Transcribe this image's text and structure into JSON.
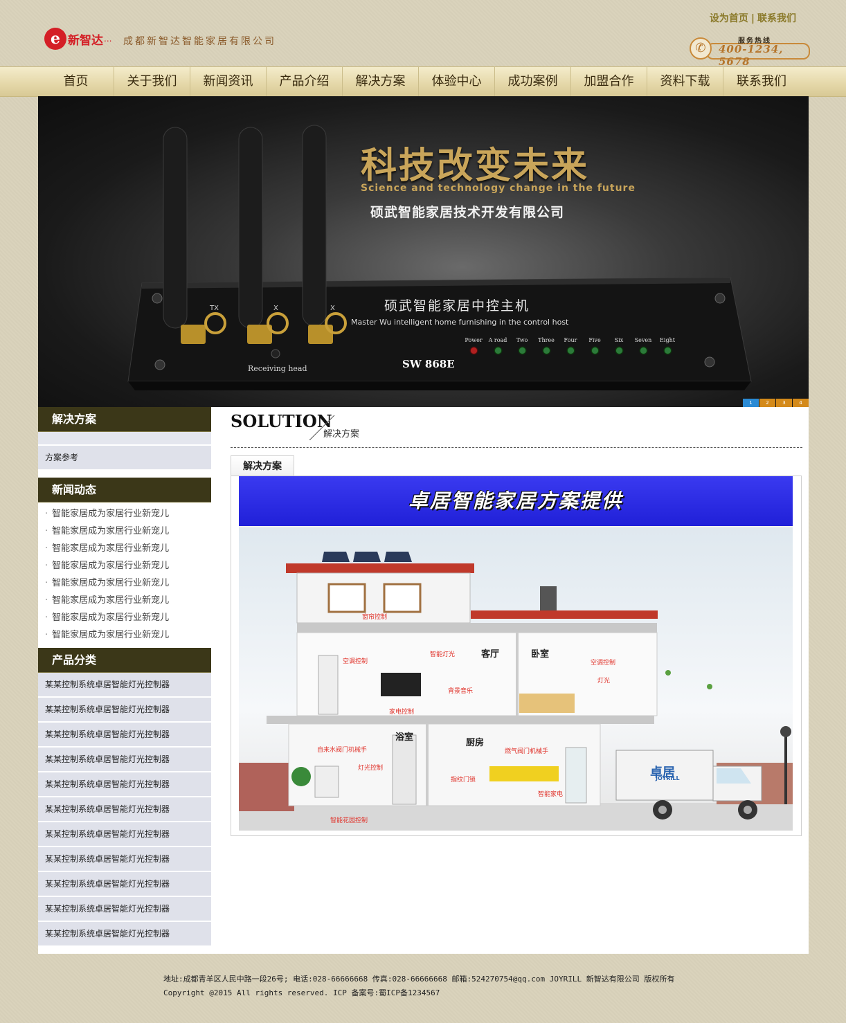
{
  "header": {
    "logo_text": "新智达",
    "logo_dots": "...",
    "company_name": "成都新智达智能家居有限公司",
    "links": [
      "设为首页",
      "联系我们"
    ],
    "hotline_label": "服务热线",
    "hotline_number": "400-1234, 5678"
  },
  "nav": [
    "首页",
    "关于我们",
    "新闻资讯",
    "产品介绍",
    "解决方案",
    "体验中心",
    "成功案例",
    "加盟合作",
    "资料下载",
    "联系我们"
  ],
  "banner": {
    "title": "科技改变未来",
    "subtitle": "Science and technology change in the future",
    "company": "硕武智能家居技术开发有限公司",
    "device_name": "硕武智能家居中控主机",
    "device_english": "Master Wu intelligent home furnishing in the control host",
    "device_model": "SW 868E",
    "receiving_label": "Receiving head",
    "antenna_labels": [
      "TX",
      "X",
      "X"
    ],
    "leds": [
      "Power",
      "A road",
      "Two",
      "Three",
      "Four",
      "Five",
      "Six",
      "Seven",
      "Eight"
    ],
    "pager": [
      "1",
      "2",
      "3",
      "4"
    ]
  },
  "sidebar": {
    "solutions_title": "解决方案",
    "solutions_items": [
      "方案参考"
    ],
    "news_title": "新闻动态",
    "news_items": [
      "智能家居成为家居行业新宠儿",
      "智能家居成为家居行业新宠儿",
      "智能家居成为家居行业新宠儿",
      "智能家居成为家居行业新宠儿",
      "智能家居成为家居行业新宠儿",
      "智能家居成为家居行业新宠儿",
      "智能家居成为家居行业新宠儿",
      "智能家居成为家居行业新宠儿"
    ],
    "products_title": "产品分类",
    "product_items": [
      "某某控制系统卓居智能灯光控制器",
      "某某控制系统卓居智能灯光控制器",
      "某某控制系统卓居智能灯光控制器",
      "某某控制系统卓居智能灯光控制器",
      "某某控制系统卓居智能灯光控制器",
      "某某控制系统卓居智能灯光控制器",
      "某某控制系统卓居智能灯光控制器",
      "某某控制系统卓居智能灯光控制器",
      "某某控制系统卓居智能灯光控制器",
      "某某控制系统卓居智能灯光控制器",
      "某某控制系统卓居智能灯光控制器"
    ]
  },
  "main": {
    "section_en": "SOLUTION",
    "section_cn": "解决方案",
    "tab_label": "解决方案",
    "image_title": "卓居智能家居方案提供",
    "house_labels": {
      "curtain": "窗帘控制",
      "ac1": "空调控制",
      "smart_light": "智能灯光",
      "living_room": "客厅",
      "bedroom": "卧室",
      "ac2": "空调控制",
      "light": "灯光",
      "music": "背景音乐",
      "appliance": "家电控制",
      "water_valve": "自来水阀门机械手",
      "bathroom": "浴室",
      "kitchen": "厨房",
      "gas_valve": "燃气阀门机械手",
      "light_ctrl": "灯光控制",
      "fingerprint": "指纹门锁",
      "smart_appliance": "智能家电",
      "garden": "智能花园控制"
    },
    "truck_brand": "卓居",
    "truck_brand_en": "JOYRILL"
  },
  "footer": {
    "line1": "地址:成都青羊区人民中路一段26号; 电话:028-66666668 传真:028-66666668 邮箱:524270754@qq.com JOYRILL 新智达有限公司 版权所有",
    "line2": "Copyright @2015 All rights reserved. ICP 备案号:蜀ICP备1234567"
  },
  "colors": {
    "page_bg": "#d9d2bb",
    "sidebar_header": "#3b3718",
    "sidebar_item": "#dfe1ea",
    "accent_gold": "#c9a55a",
    "brand_red": "#d41f26",
    "image_title_bg": "#2a2ae4"
  }
}
